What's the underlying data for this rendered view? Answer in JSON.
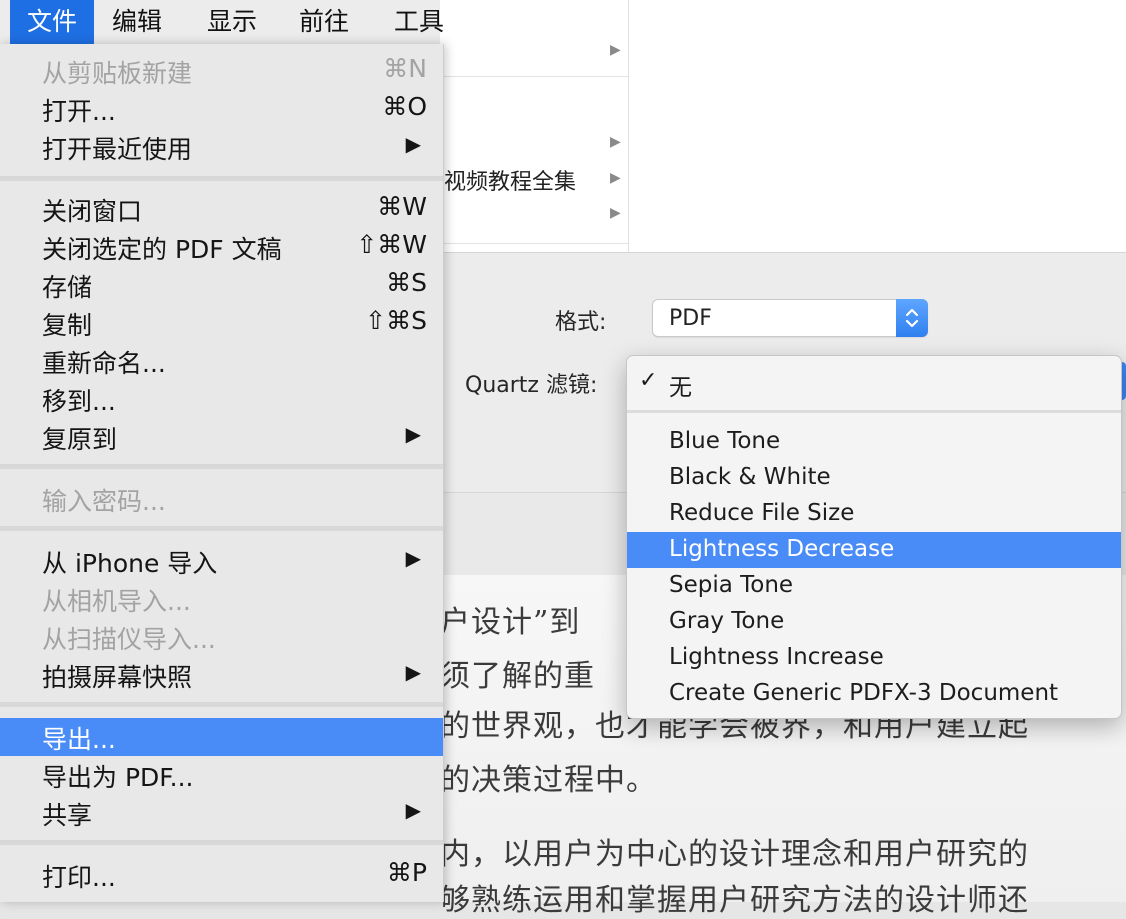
{
  "menubar": {
    "items": [
      {
        "label": "文件",
        "active": true
      },
      {
        "label": "编辑"
      },
      {
        "label": "显示"
      },
      {
        "label": "前往"
      },
      {
        "label": "工具"
      }
    ]
  },
  "file_menu": {
    "items": [
      {
        "label": "从剪贴板新建",
        "shortcut": "⌘N",
        "disabled": true
      },
      {
        "label": "打开...",
        "shortcut": "⌘O"
      },
      {
        "label": "打开最近使用",
        "submenu": true
      },
      {
        "label": "关闭窗口",
        "shortcut": "⌘W"
      },
      {
        "label": "关闭选定的 PDF 文稿",
        "shortcut": "⇧⌘W"
      },
      {
        "label": "存储",
        "shortcut": "⌘S"
      },
      {
        "label": "复制",
        "shortcut": "⇧⌘S"
      },
      {
        "label": "重新命名..."
      },
      {
        "label": "移到..."
      },
      {
        "label": "复原到",
        "submenu": true
      },
      {
        "label": "输入密码...",
        "disabled": true
      },
      {
        "label": "从 iPhone 导入",
        "submenu": true
      },
      {
        "label": "从相机导入...",
        "disabled": true
      },
      {
        "label": "从扫描仪导入...",
        "disabled": true
      },
      {
        "label": "拍摄屏幕快照",
        "submenu": true
      },
      {
        "label": "导出...",
        "highlighted": true
      },
      {
        "label": "导出为 PDF..."
      },
      {
        "label": "共享",
        "submenu": true
      },
      {
        "label": "打印...",
        "shortcut": "⌘P"
      }
    ],
    "submenu_glyph": "▶"
  },
  "browser": {
    "visible_text": "视频教程全集",
    "arrow_glyph": "▶"
  },
  "export_dialog": {
    "format_label": "格式:",
    "format_value": "PDF",
    "quartz_label": "Quartz 滤镜:"
  },
  "filter_popup": {
    "checkmark": "✓",
    "checked_item": "无",
    "items": [
      "Blue Tone",
      "Black & White",
      "Reduce File Size",
      "Lightness Decrease",
      "Sepia Tone",
      "Gray Tone",
      "Lightness Increase",
      "Create Generic PDFX-3 Document"
    ],
    "highlighted_item": "Lightness Decrease"
  },
  "document_text": {
    "lines": [
      "户设计”到",
      "须了解的重",
      "的世界观，也才能学会被界，和用户建立起",
      "的决策过程中。",
      "内，以用户为中心的设计理念和用户研究的",
      "够熟练运用和掌握用户研究方法的设计师还"
    ]
  },
  "colors": {
    "menu_highlight": "#4a8cf7",
    "menubar_active": "#1f6fe4",
    "disabled_text": "#a3a3a3"
  }
}
